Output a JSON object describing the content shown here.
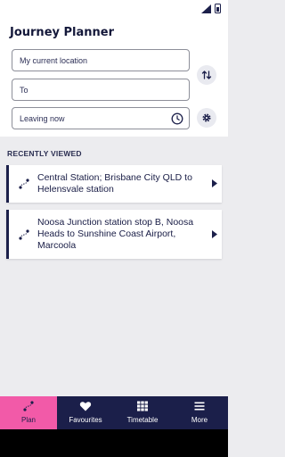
{
  "header": {
    "title": "Journey Planner"
  },
  "form": {
    "from_value": "My current location",
    "to_placeholder": "To",
    "time_value": "Leaving now"
  },
  "recent": {
    "title": "RECENTLY VIEWED",
    "items": [
      {
        "label": "Central Station; Brisbane City QLD to Helensvale station"
      },
      {
        "label": "Noosa Junction station stop B, Noosa Heads to Sunshine Coast Airport, Marcoola"
      }
    ]
  },
  "tabs": [
    {
      "label": "Plan",
      "icon": "route-icon",
      "active": true
    },
    {
      "label": "Favourites",
      "icon": "heart-icon",
      "active": false
    },
    {
      "label": "Timetable",
      "icon": "grid-icon",
      "active": false
    },
    {
      "label": "More",
      "icon": "menu-icon",
      "active": false
    }
  ],
  "colors": {
    "navy": "#1b1f4a",
    "accent_pink": "#f25aa8",
    "background": "#ececef"
  }
}
